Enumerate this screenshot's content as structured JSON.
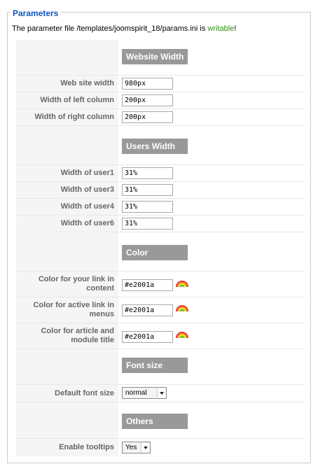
{
  "fieldset": {
    "legend": "Parameters"
  },
  "status": {
    "prefix": "The parameter file /templates/joomspirit_18/params.ini is ",
    "state": "writable",
    "suffix": "!"
  },
  "sections": {
    "website_width": "Website Width",
    "users_width": "Users Width",
    "color": "Color",
    "font_size": "Font size",
    "others": "Others"
  },
  "fields": {
    "site_width": {
      "label": "Web site width",
      "value": "980px"
    },
    "left_col": {
      "label": "Width of left column",
      "value": "200px"
    },
    "right_col": {
      "label": "Width of right column",
      "value": "200px"
    },
    "user1": {
      "label": "Width of user1",
      "value": "31%"
    },
    "user3": {
      "label": "Width of user3",
      "value": "31%"
    },
    "user4": {
      "label": "Width of user4",
      "value": "31%"
    },
    "user6": {
      "label": "Width of user6",
      "value": "31%"
    },
    "link_color": {
      "label": "Color for your link in content",
      "value": "#e2001a"
    },
    "active_color": {
      "label": "Color for active link in menus",
      "value": "#e2001a"
    },
    "title_color": {
      "label": "Color for article and module title",
      "value": "#e2001a"
    },
    "font_size": {
      "label": "Default font size",
      "value": "normal"
    },
    "tooltips": {
      "label": "Enable tooltips",
      "value": "Yes"
    }
  },
  "icons": {
    "color_picker": "rainbow-color-picker-icon"
  }
}
